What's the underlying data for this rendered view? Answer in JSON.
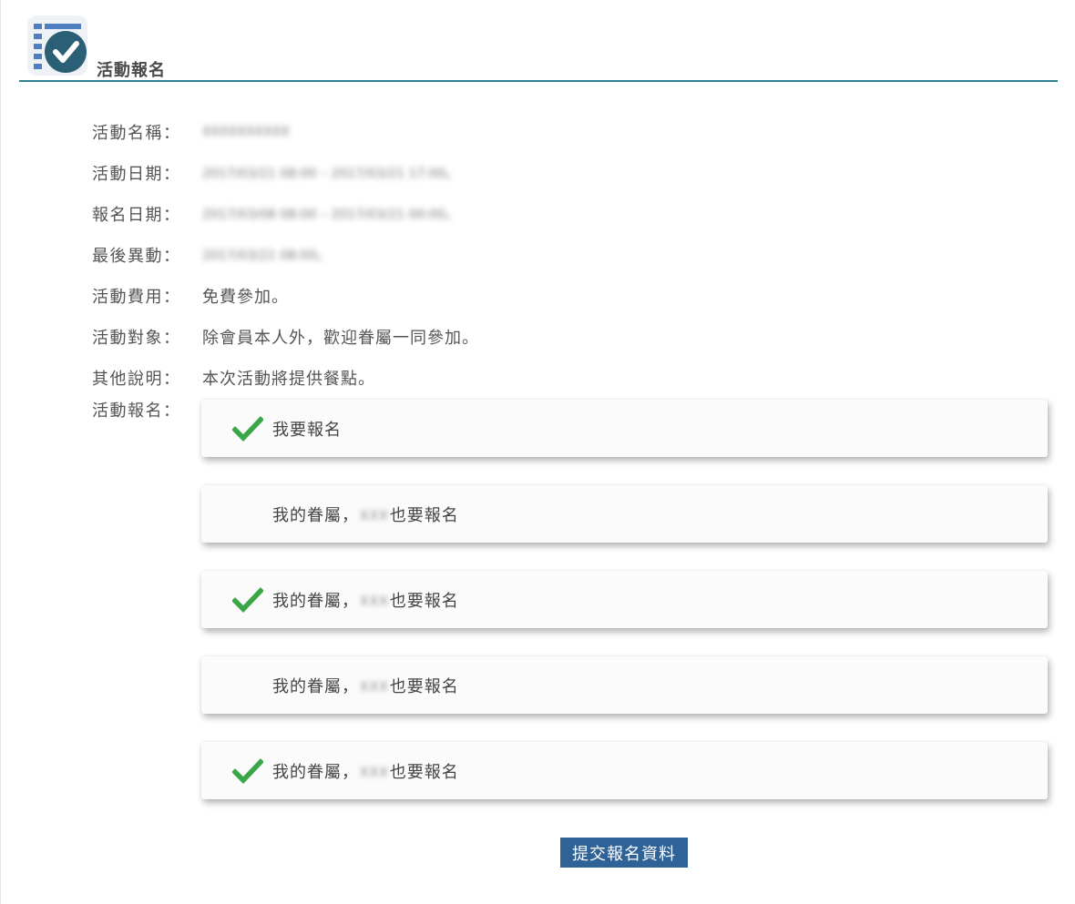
{
  "header": {
    "title": "活動報名",
    "logo_icon": "checklist-check-icon"
  },
  "info": [
    {
      "label": "活動名稱：",
      "value": "XXXXXXXXXX",
      "blurred": true
    },
    {
      "label": "活動日期：",
      "value": "2017/03/21 08:00 – 2017/03/21 17:00。",
      "blurred": true
    },
    {
      "label": "報名日期：",
      "value": "2017/03/08 08:00 – 2017/03/21 00:00。",
      "blurred": true
    },
    {
      "label": "最後異動：",
      "value": "2017/03/21 08:00。",
      "blurred": true
    },
    {
      "label": "活動費用：",
      "value": "免費參加。",
      "blurred": false
    },
    {
      "label": "活動對象：",
      "value": "除會員本人外，歡迎眷屬一同參加。",
      "blurred": false
    },
    {
      "label": "其他說明：",
      "value": "本次活動將提供餐點。",
      "blurred": false
    }
  ],
  "registration": {
    "label": "活動報名：",
    "options": [
      {
        "prefix": "我要報名",
        "name": "",
        "suffix": "",
        "checked": true
      },
      {
        "prefix": "我的眷屬，",
        "name": "XXX",
        "suffix": "也要報名",
        "checked": false
      },
      {
        "prefix": "我的眷屬，",
        "name": "XXX",
        "suffix": "也要報名",
        "checked": true
      },
      {
        "prefix": "我的眷屬，",
        "name": "XXX",
        "suffix": "也要報名",
        "checked": false
      },
      {
        "prefix": "我的眷屬，",
        "name": "XXX",
        "suffix": "也要報名",
        "checked": true
      }
    ]
  },
  "submit_label": "提交報名資料",
  "colors": {
    "accent_line": "#2f7f93",
    "check_green": "#3aa647",
    "submit_bg": "#2f6296"
  }
}
